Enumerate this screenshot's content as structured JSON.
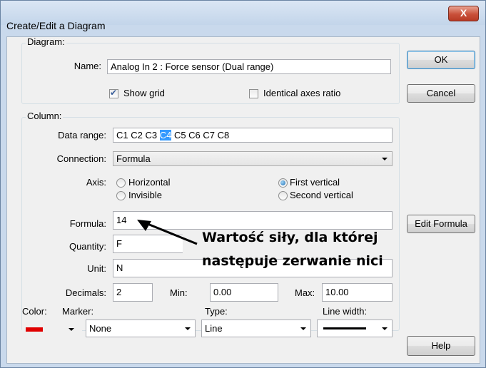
{
  "window": {
    "title": "Create/Edit a Diagram",
    "close_label": "X"
  },
  "diagram_group": {
    "label": "Diagram:",
    "name_label": "Name:",
    "name_value": "Analog In 2 : Force sensor (Dual range)",
    "show_grid_label": "Show grid",
    "show_grid_checked": true,
    "identical_axes_label": "Identical axes ratio",
    "identical_axes_checked": false
  },
  "column_group": {
    "label": "Column:",
    "data_range_label": "Data range:",
    "data_range": {
      "before": "C1  C2  C3 ",
      "selected": "C4",
      "after": " C5  C6  C7  C8"
    },
    "connection_label": "Connection:",
    "connection_value": "Formula",
    "axis_label": "Axis:",
    "axis_options": {
      "horizontal": "Horizontal",
      "invisible": "Invisible",
      "first_vertical": "First vertical",
      "second_vertical": "Second vertical"
    },
    "axis_selected": "First vertical",
    "formula_label": "Formula:",
    "formula_value": "14",
    "quantity_label": "Quantity:",
    "quantity_value": "F",
    "unit_label": "Unit:",
    "unit_value": "N",
    "decimals_label": "Decimals:",
    "decimals_value": "2",
    "min_label": "Min:",
    "min_value": "0.00",
    "max_label": "Max:",
    "max_value": "10.00"
  },
  "style": {
    "color_label": "Color:",
    "marker_label": "Marker:",
    "marker_value": "None",
    "type_label": "Type:",
    "type_value": "Line",
    "line_width_label": "Line width:",
    "color_value": "#e00000"
  },
  "buttons": {
    "ok": "OK",
    "cancel": "Cancel",
    "edit_formula": "Edit Formula",
    "help": "Help"
  },
  "annotation": {
    "line1": "Wartość siły, dla której",
    "line2": "następuje zerwanie nici"
  }
}
